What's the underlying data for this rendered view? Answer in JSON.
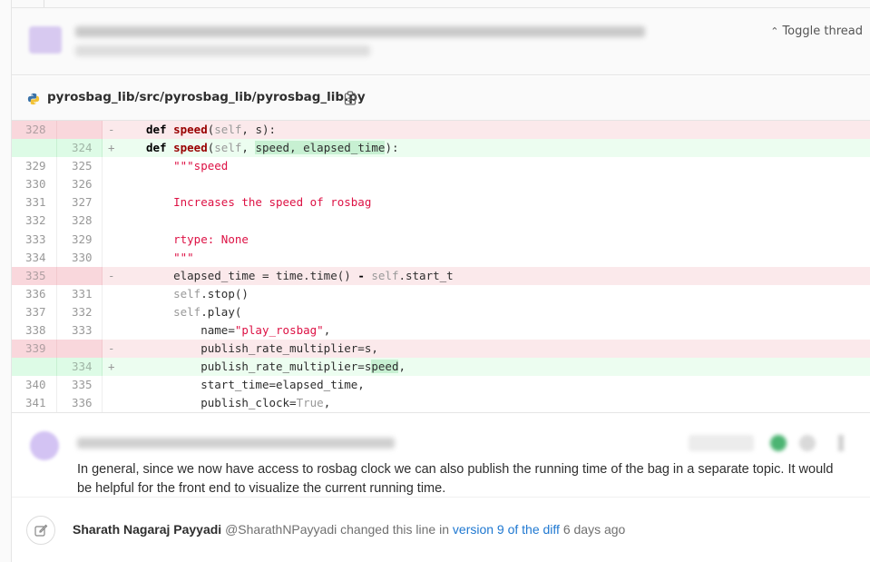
{
  "thread": {
    "toggle_label": "Toggle thread"
  },
  "file": {
    "path": "pyrosbag_lib/src/pyrosbag_lib/pyrosbag_lib.py",
    "icons": {
      "language": "python-icon",
      "copy": "copy-to-clipboard-icon"
    }
  },
  "diff": {
    "rows": [
      {
        "type": "old",
        "old": "328",
        "new": "",
        "sign": "-"
      },
      {
        "type": "new",
        "old": "",
        "new": "324",
        "sign": "+"
      },
      {
        "type": "ctx",
        "old": "329",
        "new": "325",
        "sign": ""
      },
      {
        "type": "ctx",
        "old": "330",
        "new": "326",
        "sign": ""
      },
      {
        "type": "ctx",
        "old": "331",
        "new": "327",
        "sign": ""
      },
      {
        "type": "ctx",
        "old": "332",
        "new": "328",
        "sign": ""
      },
      {
        "type": "ctx",
        "old": "333",
        "new": "329",
        "sign": ""
      },
      {
        "type": "ctx",
        "old": "334",
        "new": "330",
        "sign": ""
      },
      {
        "type": "old",
        "old": "335",
        "new": "",
        "sign": "-"
      },
      {
        "type": "ctx",
        "old": "336",
        "new": "331",
        "sign": ""
      },
      {
        "type": "ctx",
        "old": "337",
        "new": "332",
        "sign": ""
      },
      {
        "type": "ctx",
        "old": "338",
        "new": "333",
        "sign": ""
      },
      {
        "type": "old",
        "old": "339",
        "new": "",
        "sign": "-"
      },
      {
        "type": "new",
        "old": "",
        "new": "334",
        "sign": "+"
      },
      {
        "type": "ctx",
        "old": "340",
        "new": "335",
        "sign": ""
      },
      {
        "type": "ctx",
        "old": "341",
        "new": "336",
        "sign": ""
      }
    ],
    "code": {
      "r0": {
        "kw": "def ",
        "fn": "speed",
        "p1": "(",
        "self": "self",
        "p2": ", s):"
      },
      "r1": {
        "kw": "def ",
        "fn": "speed",
        "p1": "(",
        "self": "self",
        "p2": ", ",
        "hl": "speed, elapsed_time",
        "p3": "):"
      },
      "r2": {
        "indent": "    ",
        "str": "\"\"\"speed"
      },
      "r4": {
        "indent": "    ",
        "str": "Increases the speed of rosbag"
      },
      "r6": {
        "indent": "    ",
        "str": "rtype: None"
      },
      "r7": {
        "indent": "    ",
        "str": "\"\"\""
      },
      "r8": {
        "indent": "    ",
        "a": "elapsed_time = time.time() ",
        "minus": "-",
        "b": " ",
        "self": "self",
        "c": ".start_t"
      },
      "r9": {
        "indent": "    ",
        "self": "self",
        "rest": ".stop()"
      },
      "r10": {
        "indent": "    ",
        "self": "self",
        "rest": ".play("
      },
      "r11": {
        "indent": "        ",
        "a": "name=",
        "str": "\"play_rosbag\"",
        "b": ","
      },
      "r12": {
        "indent": "        ",
        "text": "publish_rate_multiplier=s,"
      },
      "r13": {
        "indent": "        ",
        "a": "publish_rate_multiplier=s",
        "hl": "peed",
        "b": ","
      },
      "r14": {
        "indent": "        ",
        "text": "start_time=elapsed_time,"
      },
      "r15": {
        "indent": "        ",
        "a": "publish_clock=",
        "kw": "True",
        "b": ","
      }
    }
  },
  "comment": {
    "text": "In general, since we now have access to rosbag clock we can also publish the running time of the bag in a separate topic. It would be helpful for the front end to visualize the current running time."
  },
  "system_note": {
    "icon": "pencil-square-icon",
    "author": "Sharath Nagaraj Payyadi",
    "handle": "@SharathNPayyadi",
    "action": "changed this line in",
    "link": "version 9 of the diff",
    "time": "6 days ago"
  },
  "colors": {
    "removed_bg": "#fbe9eb",
    "added_bg": "#ecfdf0",
    "link": "#1f78d1",
    "function": "#990000",
    "string": "#dd1144"
  }
}
